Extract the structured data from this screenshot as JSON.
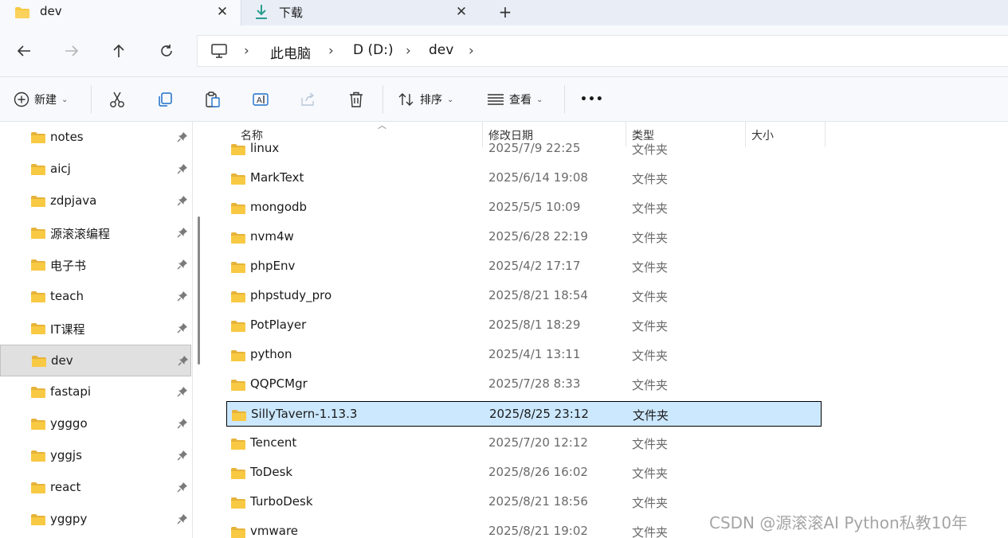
{
  "tabs": [
    {
      "label": "dev",
      "icon": "folder-icon",
      "active": true
    },
    {
      "label": "下载",
      "icon": "download-icon",
      "active": false
    }
  ],
  "breadcrumb": [
    "此电脑",
    "D (D:)",
    "dev"
  ],
  "toolbar": {
    "new_label": "新建",
    "sort_label": "排序",
    "view_label": "查看",
    "more_label": "•••"
  },
  "sidebar": {
    "items": [
      {
        "label": "notes"
      },
      {
        "label": "aicj"
      },
      {
        "label": "zdpjava"
      },
      {
        "label": "源滚滚编程"
      },
      {
        "label": "电子书"
      },
      {
        "label": "teach"
      },
      {
        "label": "IT课程"
      },
      {
        "label": "dev",
        "selected": true
      },
      {
        "label": "fastapi"
      },
      {
        "label": "ygggo"
      },
      {
        "label": "yggjs"
      },
      {
        "label": "react"
      },
      {
        "label": "yggpy"
      }
    ]
  },
  "columns": {
    "name": "名称",
    "date": "修改日期",
    "type": "类型",
    "size": "大小"
  },
  "files": [
    {
      "name": "linux",
      "date": "2025/7/9 22:25",
      "type": "文件夹"
    },
    {
      "name": "MarkText",
      "date": "2025/6/14 19:08",
      "type": "文件夹"
    },
    {
      "name": "mongodb",
      "date": "2025/5/5 10:09",
      "type": "文件夹"
    },
    {
      "name": "nvm4w",
      "date": "2025/6/28 22:19",
      "type": "文件夹"
    },
    {
      "name": "phpEnv",
      "date": "2025/4/2 17:17",
      "type": "文件夹"
    },
    {
      "name": "phpstudy_pro",
      "date": "2025/8/21 18:54",
      "type": "文件夹"
    },
    {
      "name": "PotPlayer",
      "date": "2025/8/1 18:29",
      "type": "文件夹"
    },
    {
      "name": "python",
      "date": "2025/4/1 13:11",
      "type": "文件夹"
    },
    {
      "name": "QQPCMgr",
      "date": "2025/7/28 8:33",
      "type": "文件夹"
    },
    {
      "name": "SillyTavern-1.13.3",
      "date": "2025/8/25 23:12",
      "type": "文件夹",
      "selected": true
    },
    {
      "name": "Tencent",
      "date": "2025/7/20 12:12",
      "type": "文件夹"
    },
    {
      "name": "ToDesk",
      "date": "2025/8/26 16:02",
      "type": "文件夹"
    },
    {
      "name": "TurboDesk",
      "date": "2025/8/21 18:56",
      "type": "文件夹"
    },
    {
      "name": "vmware",
      "date": "2025/8/21 19:02",
      "type": "文件夹"
    }
  ],
  "watermark": "CSDN @源滚滚AI Python私教10年",
  "colors": {
    "folder": "#f8c943",
    "folder_dark": "#e6a817",
    "selection": "#cce8ff",
    "accent": "#2a9d8f"
  }
}
